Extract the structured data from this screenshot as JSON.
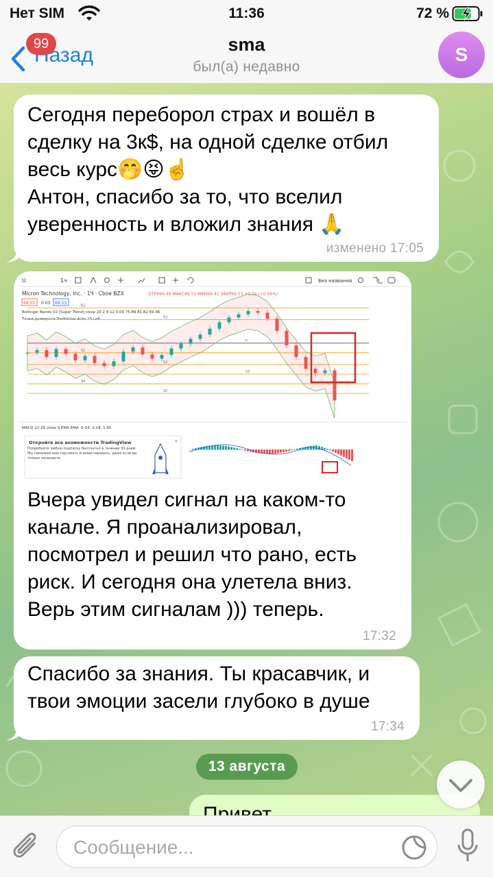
{
  "status_bar": {
    "carrier": "Нет SIM",
    "time": "11:36",
    "battery_percent": "72 %",
    "battery_level": 0.72
  },
  "header": {
    "back_label": "Назад",
    "unread_count": "99",
    "title": "sma",
    "subtitle": "был(а) недавно",
    "avatar_letter": "S"
  },
  "messages": [
    {
      "text": "Сегодня переборол страх и вошёл в\nсделку на 3к$, на одной сделке отбил\nвесь курс🤭😝☝️\nАнтон, спасибо за то, что вселил\nуверенность и вложил знания 🙏",
      "meta": "изменено 17:05"
    },
    {
      "text": "Вчера увидел сигнал на каком-то\nканале. Я проанализировал,\nпосмотрел и решил что рано, есть\nриск. И сегодня она улетела вниз.\nВерь этим сигналам ))) теперь.",
      "meta": "17:32",
      "photo": {
        "toolbar_interval": "1ч",
        "unnamed_label": "Без названия",
        "symbol_title": "Micron Technology, Inc. · 1Ч · Cboe BZX",
        "ohlc": "ОТКР69.49 МАКС69.53 МИН69.41 ЗАКР69.53 +0.04 (+0.06%)",
        "price_sell": "69.50",
        "spread": "0.03",
        "price_buy": "69.53",
        "bollinger": "Bollinger Bands V2 [Super Trend] close 20 2 4 12  0.00 75.89 81.82 69.96",
        "pivots": "Точки разворота Traditional Auto 15 Left",
        "macd": "MACD 12 26 close 9 EMA EMA  -0.54  -2.18  -1.65",
        "promo_title": "Откройте все возможности TradingView",
        "promo_body": "Попробуйте любую подписку бесплатно в течение 30 дней. Мы поможем вам торговать и инвестировать, даже если вы только начинаете.",
        "level_labels": [
          "R2",
          "R1",
          "P",
          "S1",
          "S2",
          "S3",
          "S4",
          "S5"
        ],
        "chart_data": {
          "type": "line",
          "title": "Micron Technology, Inc.",
          "series": [
            {
              "name": "close",
              "values": [
                78.4,
                78.9,
                77.6,
                79.1,
                78.2,
                77.0,
                77.8,
                76.5,
                75.9,
                76.8,
                78.6,
                79.4,
                78.1,
                77.3,
                78.0,
                79.2,
                80.1,
                81.0,
                81.8,
                82.9,
                84.1,
                85.0,
                85.6,
                86.2,
                85.9,
                84.8,
                82.5,
                79.8,
                77.6,
                75.4,
                74.6,
                75.1,
                69.5
              ]
            }
          ]
        }
      }
    },
    {
      "text": "Спасибо за знания. Ты красавчик, и\nтвои эмоции засели глубоко в душе",
      "meta": "17:34"
    }
  ],
  "date_separator": "13 августа",
  "outgoing_preview": "Привет",
  "input": {
    "placeholder": "Сообщение...",
    "value": ""
  },
  "colors": {
    "accent": "#1f7fe0",
    "badge": "#e0464a",
    "outgoing_bubble": "#e2fcc7",
    "date_pill": "#5a9b53",
    "candle_up": "#26a69a",
    "candle_down": "#ef5350",
    "highlight": "#d62828"
  }
}
